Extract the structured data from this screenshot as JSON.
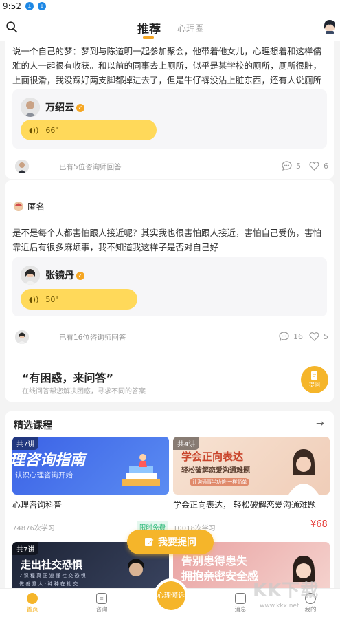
{
  "status_bar": {
    "time": "9:52"
  },
  "header": {
    "tabs": [
      {
        "label": "推荐",
        "active": true
      },
      {
        "label": "心理圈",
        "active": false
      }
    ]
  },
  "feed": [
    {
      "question": "说一个自己的梦：梦到与陈道明一起参加聚会，他带着他女儿，心理想着和这样儒雅的人一起很有收获。和以前的同事去上厕所，似乎是某学校的厕所，厕所很脏，上面很滑，我没踩好两支脚都掉进去了，但是牛仔裤没沾上脏东西，还有人说厕所把过去的脏东西呆…",
      "answerer": "万绍云",
      "voice_duration": "66\"",
      "answered_text": "已有5位咨询师回答",
      "comments": "5",
      "likes": "6"
    },
    {
      "asker": "匿名",
      "question": "是不是每个人都害怕跟人接近呢？其实我也很害怕跟人接近，害怕自己受伤，害怕靠近后有很多麻烦事，我不知道我这样子是否对自己好",
      "answerer": "张镜丹",
      "voice_duration": "50\"",
      "answered_text": "已有16位咨询师回答",
      "comments": "16",
      "likes": "5"
    }
  ],
  "ask_banner": {
    "title": "“有困惑，来问答”",
    "subtitle": "在线问答帮您解决困惑，寻求不同的答案",
    "button_label": "提问"
  },
  "courses_section": {
    "title": "精选课程",
    "courses": [
      {
        "badge": "共7讲",
        "banner_main": "理咨询指南",
        "banner_sub": "认识心理咨询开始",
        "title": "心理咨询科普",
        "count": "74876次学习",
        "tag": "限时免费",
        "price": ""
      },
      {
        "badge": "共4讲",
        "banner_main": "学会正向表达",
        "banner_sub": "轻松破解恋爱沟通难题",
        "banner_small": "让沟通事半功倍·一样简单",
        "title": "学会正向表达， 轻松破解恋爱沟通难题",
        "count": "10018次学习",
        "tag": "",
        "price": "¥68"
      },
      {
        "badge": "共7讲",
        "banner_main": "走出社交恐惧",
        "banner_sub": "7 课 程 真 正 道 懂 社 交 恐 惧",
        "banner_small": "做 善 意 人 · 种 种 在 社 交",
        "title": "",
        "count": "",
        "tag": "",
        "price": ""
      },
      {
        "badge": "",
        "banner_main": "告别患得患失",
        "banner_sub": "拥抱亲密安全感",
        "title": "",
        "count": "",
        "tag": "",
        "price": ""
      }
    ]
  },
  "float_button": {
    "label": "我要提问"
  },
  "bottom_nav": [
    {
      "label": "首页",
      "active": true
    },
    {
      "label": "咨询",
      "active": false
    },
    {
      "label": "心理倾诉",
      "active": false
    },
    {
      "label": "消息",
      "active": false
    },
    {
      "label": "我的",
      "active": false
    }
  ],
  "watermark": {
    "text": "KK下载",
    "url": "www.kkx.net"
  },
  "colors": {
    "accent": "#f5b52a",
    "voice_bg": "#ffd95a",
    "free_tag": "#22b573",
    "price": "#e53935"
  }
}
